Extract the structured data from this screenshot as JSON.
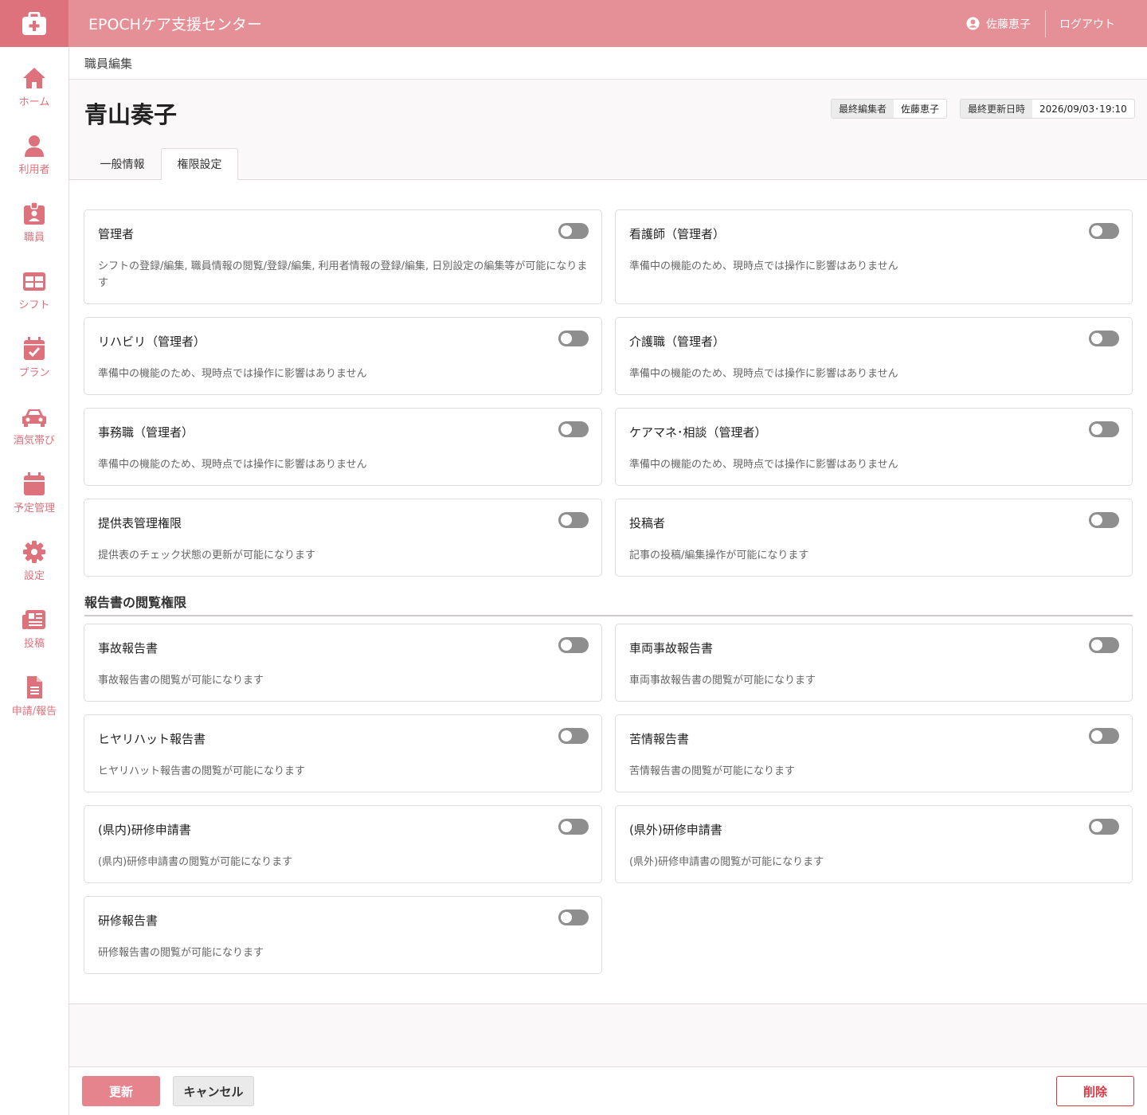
{
  "header": {
    "app_title": "EPOCHケア支援センター",
    "user_name": "佐藤恵子",
    "logout_label": "ログアウト"
  },
  "sidebar": {
    "items": [
      {
        "label": "ホーム",
        "icon": "home-icon"
      },
      {
        "label": "利用者",
        "icon": "person-icon"
      },
      {
        "label": "職員",
        "icon": "id-badge-icon"
      },
      {
        "label": "シフト",
        "icon": "table-icon"
      },
      {
        "label": "プラン",
        "icon": "calendar-check-icon"
      },
      {
        "label": "酒気帯び",
        "icon": "car-icon"
      },
      {
        "label": "予定管理",
        "icon": "calendar-icon"
      },
      {
        "label": "設定",
        "icon": "gear-icon"
      },
      {
        "label": "投稿",
        "icon": "newspaper-icon"
      },
      {
        "label": "申請/報告",
        "icon": "document-icon"
      }
    ]
  },
  "breadcrumb": "職員編集",
  "page_title": "青山奏子",
  "meta": {
    "last_editor_label": "最終編集者",
    "last_editor_value": "佐藤恵子",
    "last_updated_label": "最終更新日時",
    "last_updated_value": "2026/09/03･19:10"
  },
  "tabs": [
    {
      "label": "一般情報",
      "active": false
    },
    {
      "label": "権限設定",
      "active": true
    }
  ],
  "permissions": [
    {
      "title": "管理者",
      "desc": "シフトの登録/編集, 職員情報の閲覧/登録/編集, 利用者情報の登録/編集, 日別設定の編集等が可能になります",
      "enabled": false
    },
    {
      "title": "看護師（管理者）",
      "desc": "準備中の機能のため、現時点では操作に影響はありません",
      "enabled": false
    },
    {
      "title": "リハビリ（管理者）",
      "desc": "準備中の機能のため、現時点では操作に影響はありません",
      "enabled": false
    },
    {
      "title": "介護職（管理者）",
      "desc": "準備中の機能のため、現時点では操作に影響はありません",
      "enabled": false
    },
    {
      "title": "事務職（管理者）",
      "desc": "準備中の機能のため、現時点では操作に影響はありません",
      "enabled": false
    },
    {
      "title": "ケアマネ･相談（管理者）",
      "desc": "準備中の機能のため、現時点では操作に影響はありません",
      "enabled": false
    },
    {
      "title": "提供表管理権限",
      "desc": "提供表のチェック状態の更新が可能になります",
      "enabled": false
    },
    {
      "title": "投稿者",
      "desc": "記事の投稿/編集操作が可能になります",
      "enabled": false
    }
  ],
  "report_section_title": "報告書の閲覧権限",
  "reports": [
    {
      "title": "事故報告書",
      "desc": "事故報告書の閲覧が可能になります",
      "enabled": false
    },
    {
      "title": "車両事故報告書",
      "desc": "車両事故報告書の閲覧が可能になります",
      "enabled": false
    },
    {
      "title": "ヒヤリハット報告書",
      "desc": "ヒヤリハット報告書の閲覧が可能になります",
      "enabled": false
    },
    {
      "title": "苦情報告書",
      "desc": "苦情報告書の閲覧が可能になります",
      "enabled": false
    },
    {
      "title": "(県内)研修申請書",
      "desc": "(県内)研修申請書の閲覧が可能になります",
      "enabled": false
    },
    {
      "title": "(県外)研修申請書",
      "desc": "(県外)研修申請書の閲覧が可能になります",
      "enabled": false
    },
    {
      "title": "研修報告書",
      "desc": "研修報告書の閲覧が可能になります",
      "enabled": false
    }
  ],
  "footer": {
    "update_label": "更新",
    "cancel_label": "キャンセル",
    "delete_label": "削除"
  },
  "colors": {
    "brand": "#e59096",
    "brand_dark": "#de727c",
    "toggle_off": "#8e8e8e",
    "danger": "#d63a44"
  }
}
